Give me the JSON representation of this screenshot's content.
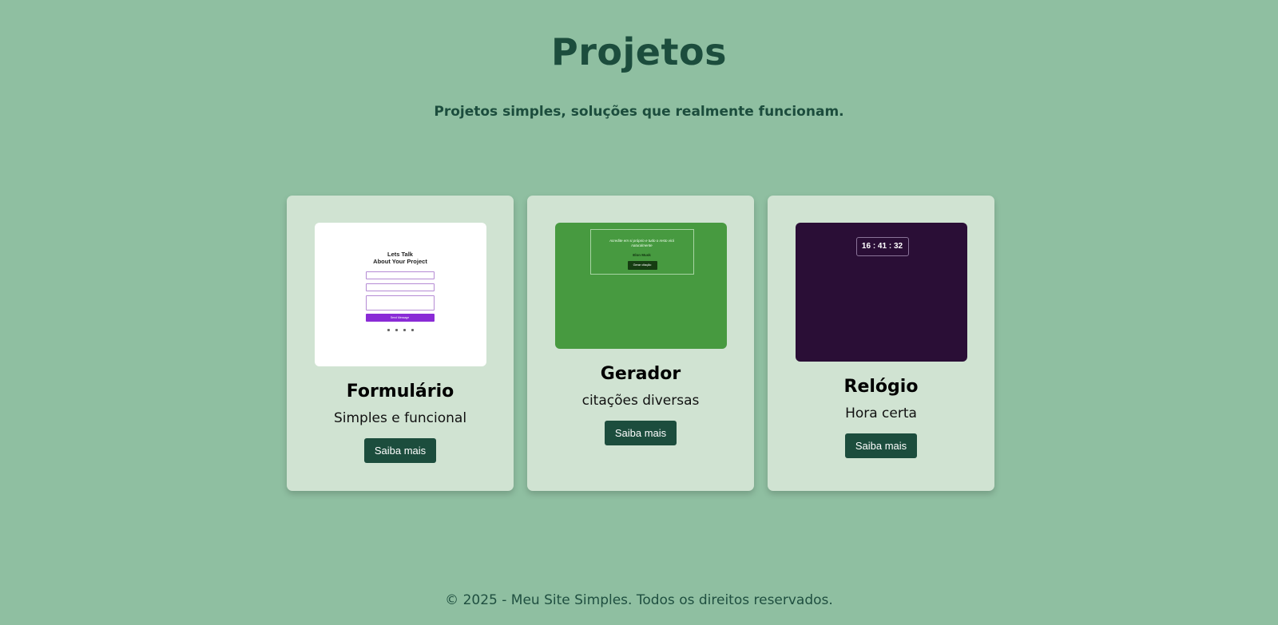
{
  "header": {
    "title": "Projetos",
    "subtitle": "Projetos simples, soluções que realmente funcionam."
  },
  "projects": [
    {
      "title": "Formulário",
      "description": "Simples e funcional",
      "button_label": "Saiba mais",
      "thumb_bg": "#ffffff",
      "preview": {
        "heading_1": "Lets Talk",
        "heading_2": "About Your Project",
        "send_label": "Send Message"
      }
    },
    {
      "title": "Gerador",
      "description": "citações diversas",
      "button_label": "Saiba mais",
      "thumb_bg": "#479a40",
      "preview": {
        "quote": "Acredite em si próprio e tudo o resto virá naturalmente",
        "author": "Elon Musk",
        "button_label": "Gerar citação"
      }
    },
    {
      "title": "Relógio",
      "description": "Hora certa",
      "button_label": "Saiba mais",
      "thumb_bg": "#2a0e36",
      "preview": {
        "time": "16 : 41 : 32"
      }
    }
  ],
  "footer": {
    "text": "© 2025 - Meu Site Simples. Todos os direitos reservados."
  },
  "colors": {
    "page_bg": "#8fbfa1",
    "card_bg": "#d0e3d2",
    "accent": "#1c4d3d"
  }
}
